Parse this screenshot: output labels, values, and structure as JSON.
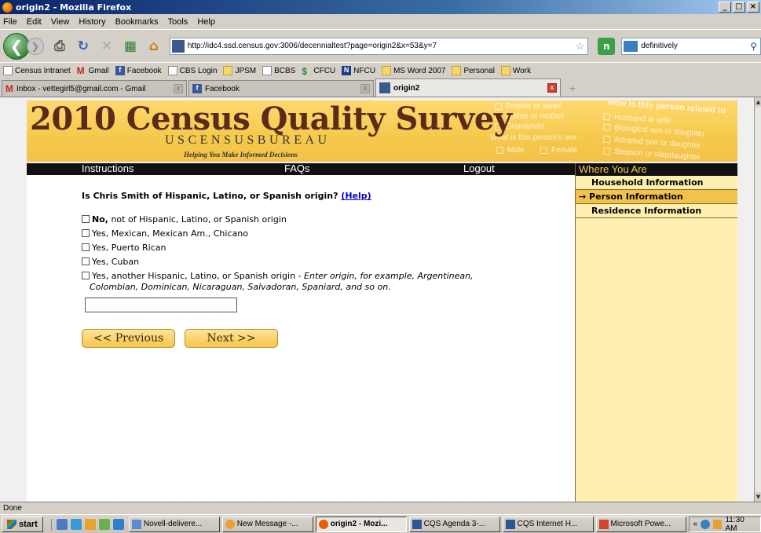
{
  "window": {
    "title": "origin2 - Mozilla Firefox",
    "buttons": [
      "_",
      "□",
      "×"
    ]
  },
  "menu": [
    "File",
    "Edit",
    "View",
    "History",
    "Bookmarks",
    "Tools",
    "Help"
  ],
  "nav": {
    "url": "http://idc4.ssd.census.gov:3006/decennialtest?page=origin2&x=53&y=7",
    "search_value": "definitively"
  },
  "bookmarks": [
    {
      "label": "Census Intranet",
      "icon": "page"
    },
    {
      "label": "Gmail",
      "icon": "gmail"
    },
    {
      "label": "Facebook",
      "icon": "fb"
    },
    {
      "label": "CBS Login",
      "icon": "page"
    },
    {
      "label": "JPSM",
      "icon": "folder"
    },
    {
      "label": "BCBS",
      "icon": "page"
    },
    {
      "label": "CFCU",
      "icon": "dollar"
    },
    {
      "label": "NFCU",
      "icon": "nfcu"
    },
    {
      "label": "MS Word 2007",
      "icon": "folder"
    },
    {
      "label": "Personal",
      "icon": "folder"
    },
    {
      "label": "Work",
      "icon": "folder"
    }
  ],
  "tabs": [
    {
      "label": "Inbox - vettegirl5@gmail.com - Gmail",
      "active": false
    },
    {
      "label": "Facebook",
      "active": false
    },
    {
      "label": "origin2",
      "active": true
    }
  ],
  "banner": {
    "title": "2010 Census Quality Survey",
    "bureau": "USCENSUSBUREAU",
    "tagline": "Helping You Make Informed Decisions",
    "ghost_text": [
      "Brother or sister",
      "Father or mother",
      "Grandchild",
      "What is this person's sex",
      "Male",
      "Female",
      "How is this person related to",
      "Husband or wife",
      "Biological son or daughter",
      "Adopted son or daughter",
      "Stepson or stepdaughter"
    ]
  },
  "topnav": {
    "instructions": "Instructions",
    "faqs": "FAQs",
    "logout": "Logout"
  },
  "question": {
    "text": "Is Chris Smith of Hispanic, Latino, or Spanish origin?",
    "help": "(Help)"
  },
  "options": {
    "no_bold": "No,",
    "no_rest": " not of Hispanic, Latino, or Spanish origin",
    "mexican": "Yes, Mexican, Mexican Am., Chicano",
    "puerto_rican": "Yes, Puerto Rican",
    "cuban": "Yes, Cuban",
    "another_plain": "Yes, another Hispanic, Latino, or Spanish origin - ",
    "another_italic": "Enter origin, for example, Argentinean,",
    "another_line2": "Colombian, Dominican, Nicaraguan, Salvadoran, Spaniard, and so on."
  },
  "origin_input_value": "",
  "buttons": {
    "previous": "<< Previous",
    "next": "Next >>"
  },
  "sidebar": {
    "heading": "Where You Are",
    "items": [
      {
        "label": "Household Information",
        "active": false
      },
      {
        "label": "→ Person Information",
        "active": true
      },
      {
        "label": "Residence Information",
        "active": false
      }
    ]
  },
  "status": "Done",
  "taskbar": {
    "start": "start",
    "tasks": [
      {
        "label": "Novell-delivere...",
        "active": false
      },
      {
        "label": "New Message -...",
        "active": false
      },
      {
        "label": "origin2 - Mozi...",
        "active": true
      },
      {
        "label": "CQS Agenda 3-...",
        "active": false
      },
      {
        "label": "CQS Internet H...",
        "active": false
      },
      {
        "label": "Microsoft Powe...",
        "active": false
      }
    ],
    "tray_arrows": "«",
    "clock": "11:30 AM"
  }
}
